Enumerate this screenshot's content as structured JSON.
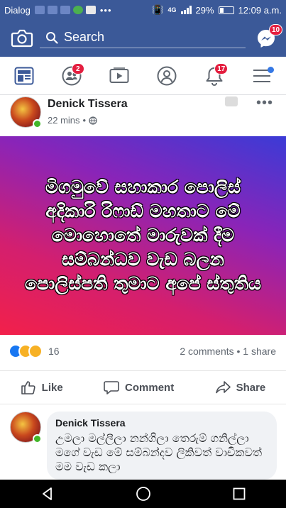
{
  "status_bar": {
    "carrier": "Dialog",
    "overflow": "•••",
    "network": "4G",
    "battery": "29%",
    "time": "12:09 a.m."
  },
  "top_bar": {
    "search_placeholder": "Search",
    "messenger_badge": "10"
  },
  "nav_tabs": {
    "friends_badge": "2",
    "notifications_badge": "17"
  },
  "post": {
    "author": "Denick Tissera",
    "time": "22 mins",
    "separator": "•",
    "more": "•••",
    "image_text": "මිගමුවේ සහාකාර පොලිස් අදිකාරි රිෆාඩ් මහතාට මේ මොහොතේ මාරුවක් දීම සම්බන්ධව වැඩ බලන පොලිස්පති තුමාට අපේ ස්තුතිය",
    "reaction_count": "16",
    "comments_share": "2 comments • 1 share"
  },
  "actions": {
    "like": "Like",
    "comment": "Comment",
    "share": "Share"
  },
  "comment": {
    "author": "Denick Tissera",
    "text": "උමලා මල්ලීලා නන්ගිලා තෙරුම් ගනිල්ලා මගේ වැඩ මේ සම්බන්දව ලිකිවත් වාචිකවත් මම වැඩ කලා"
  },
  "colors": {
    "brand": "#3b5998",
    "badge": "#e41e3f",
    "online": "#42b72a"
  }
}
